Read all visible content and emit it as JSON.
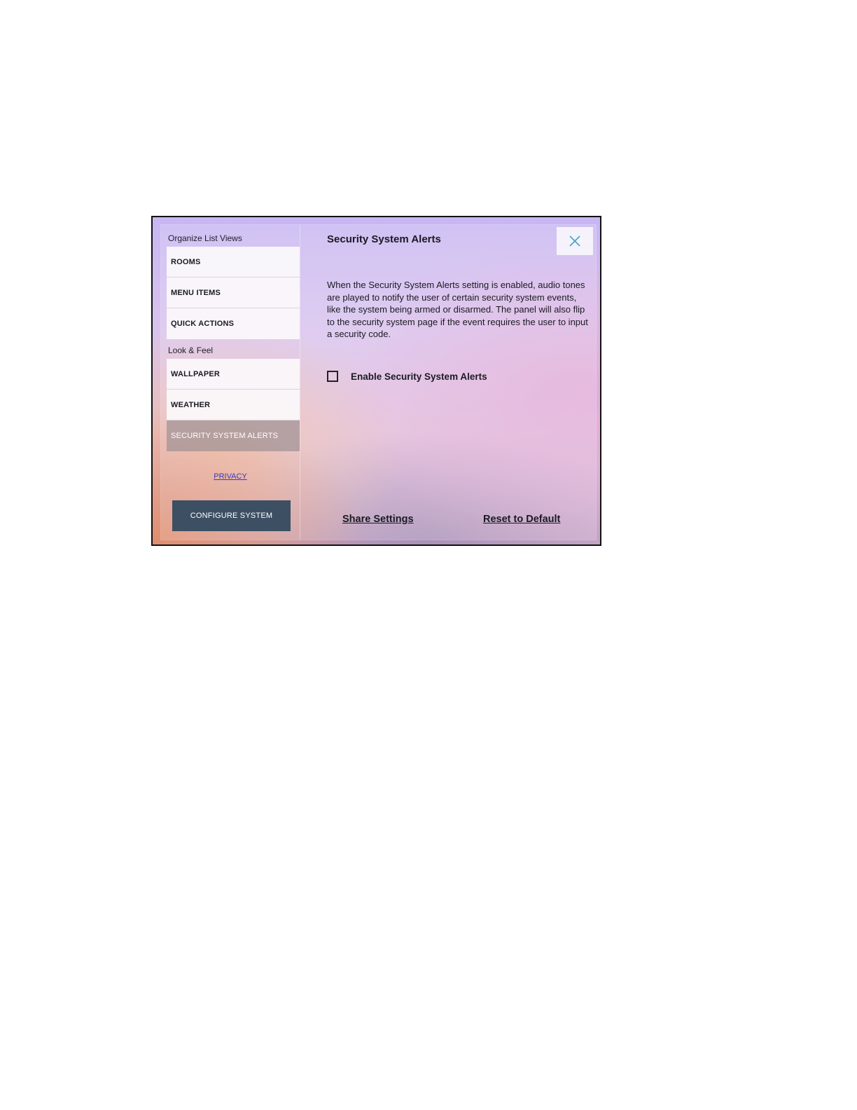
{
  "sidebar": {
    "section1_title": "Organize List Views",
    "section1_items": [
      {
        "label": "ROOMS"
      },
      {
        "label": "MENU ITEMS"
      },
      {
        "label": "QUICK ACTIONS"
      }
    ],
    "section2_title": "Look & Feel",
    "section2_items": [
      {
        "label": "WALLPAPER"
      },
      {
        "label": "WEATHER"
      },
      {
        "label": "SECURITY SYSTEM ALERTS",
        "active": true
      }
    ],
    "privacy_label": "PRIVACY",
    "configure_label": "CONFIGURE SYSTEM"
  },
  "content": {
    "title": "Security System Alerts",
    "description": "When the Security System Alerts setting is enabled, audio tones are played to notify the user of certain security system events, like the system being armed or disarmed. The panel will also flip to the security system page if the event requires the user to input a security code.",
    "checkbox_label": "Enable Security System Alerts",
    "checkbox_checked": false,
    "share_label": "Share Settings",
    "reset_label": "Reset to Default",
    "close_icon": "close-icon"
  },
  "colors": {
    "accent_close": "#4aa8c8",
    "configure_button": "#3d4f63",
    "active_item": "#a0918f",
    "link": "#3a3ab8"
  }
}
